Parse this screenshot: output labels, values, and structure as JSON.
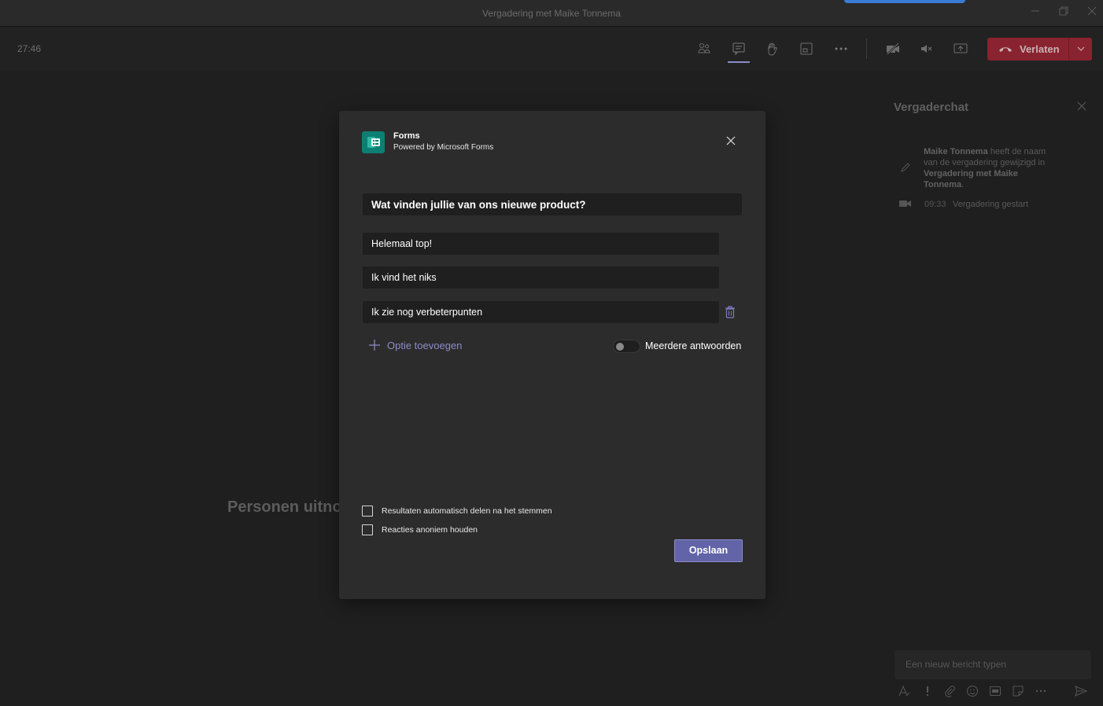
{
  "window": {
    "title": "Vergadering met Maike Tonnema",
    "controls": [
      "minimize-icon",
      "restore-icon",
      "close-icon"
    ]
  },
  "toolbar": {
    "timer": "27:46",
    "icons": [
      "participants-icon",
      "chat-icon",
      "raise-hand-icon",
      "layout-icon",
      "more-icon",
      "camera-off-icon",
      "speaker-mute-icon",
      "share-screen-icon"
    ],
    "leave_label": "Verlaten",
    "leave_color": "#9c2432"
  },
  "stage": {
    "text": "Personen uitnodigen"
  },
  "chat": {
    "title": "Vergaderchat",
    "rename_message": {
      "actor": "Maike Tonnema",
      "text": " heeft de naam van de vergadering gewijzigd in ",
      "new_name": "Vergadering met Maike Tonnema",
      "suffix": "."
    },
    "event_time": "09:33",
    "event_text": "Vergadering gestart",
    "input_placeholder": "Een nieuw bericht typen",
    "tool_icons": [
      "format-icon",
      "important-icon",
      "attach-icon",
      "emoji-icon",
      "gif-icon",
      "sticker-icon",
      "more-icon",
      "send-icon"
    ]
  },
  "dialog": {
    "app_name": "Forms",
    "app_subtitle": "Powered by Microsoft Forms",
    "question": "Wat vinden jullie van ons nieuwe product?",
    "options": [
      "Helemaal top!",
      "Ik vind het niks",
      "Ik zie nog verbeterpunten"
    ],
    "add_option_label": "Optie toevoegen",
    "multiple_answers_label": "Meerdere antwoorden",
    "multiple_answers_enabled": false,
    "checkbox_share_results": "Resultaten automatisch delen na het stemmen",
    "checkbox_anonymous": "Reacties anoniem houden",
    "save_label": "Opslaan",
    "accent_color": "#6264a7"
  }
}
